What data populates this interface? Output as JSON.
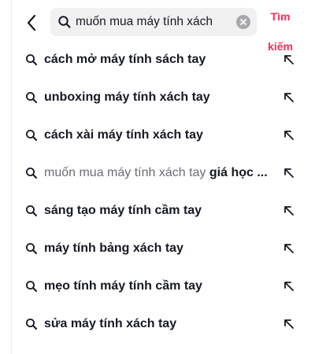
{
  "search": {
    "value": "muốn mua máy tính xách",
    "button_label": "Tìm kiếm"
  },
  "suggestions": [
    {
      "text": "cách mở máy tính sách tay"
    },
    {
      "text": "unboxing máy tính xách tay"
    },
    {
      "text": "cách xài máy tính xách tay"
    },
    {
      "prefix": "muốn mua máy tính xách tay ",
      "text": "giá học ..."
    },
    {
      "text": "sáng tạo máy tính cầm tay"
    },
    {
      "text": "máy tính bảng xách tay"
    },
    {
      "text": "mẹo tính máy tính cầm tay"
    },
    {
      "text": "sửa máy tính xách tay"
    }
  ],
  "colors": {
    "accent": "#fe2c55",
    "search_bg": "#f1f1f2",
    "text": "#161823"
  },
  "icons": {
    "back": "chevron-left-icon",
    "search": "search-icon",
    "clear": "clear-icon",
    "fill": "arrow-up-left-icon"
  }
}
